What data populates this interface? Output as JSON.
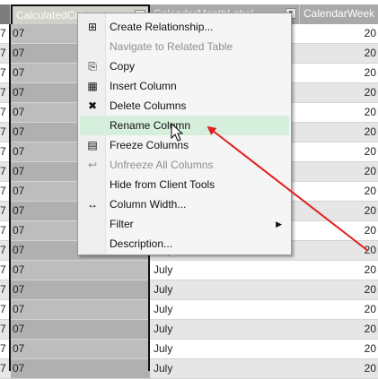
{
  "grid": {
    "columns": [
      "",
      "CalculatedColumn1",
      "CalendarMonthLabel",
      "CalendarWeek"
    ],
    "header_calc": "CalculatedCol",
    "header_month": "CalendarMonthLabel",
    "header_week": "CalendarWeek",
    "rows": [
      {
        "left": "7",
        "calc": "07",
        "month": "July",
        "week": "20"
      },
      {
        "left": "7",
        "calc": "07",
        "month": "July",
        "week": "20"
      },
      {
        "left": "7",
        "calc": "07",
        "month": "July",
        "week": "20"
      },
      {
        "left": "7",
        "calc": "07",
        "month": "July",
        "week": "20"
      },
      {
        "left": "7",
        "calc": "07",
        "month": "July",
        "week": "20"
      },
      {
        "left": "7",
        "calc": "07",
        "month": "July",
        "week": "20"
      },
      {
        "left": "7",
        "calc": "07",
        "month": "July",
        "week": "20"
      },
      {
        "left": "7",
        "calc": "07",
        "month": "July",
        "week": "20"
      },
      {
        "left": "7",
        "calc": "07",
        "month": "July",
        "week": "20"
      },
      {
        "left": "7",
        "calc": "07",
        "month": "July",
        "week": "20"
      },
      {
        "left": "7",
        "calc": "07",
        "month": "July",
        "week": "20"
      },
      {
        "left": "7",
        "calc": "07",
        "month": "July",
        "week": "20"
      },
      {
        "left": "7",
        "calc": "07",
        "month": "July",
        "week": "20"
      },
      {
        "left": "7",
        "calc": "07",
        "month": "July",
        "week": "20"
      },
      {
        "left": "7",
        "calc": "07",
        "month": "July",
        "week": "20"
      },
      {
        "left": "7",
        "calc": "07",
        "month": "July",
        "week": "20"
      },
      {
        "left": "7",
        "calc": "07",
        "month": "July",
        "week": "20"
      },
      {
        "left": "7",
        "calc": "07",
        "month": "July",
        "week": "20"
      }
    ]
  },
  "menu": {
    "items": [
      {
        "label": "Create Relationship...",
        "icon": "create-relationship-icon",
        "glyph": "⊞",
        "disabled": false
      },
      {
        "label": "Navigate to Related Table",
        "icon": "navigate-related-icon",
        "glyph": "",
        "disabled": true
      },
      {
        "label": "Copy",
        "icon": "copy-icon",
        "glyph": "⎘",
        "disabled": false
      },
      {
        "label": "Insert Column",
        "icon": "insert-column-icon",
        "glyph": "▦",
        "disabled": false
      },
      {
        "label": "Delete Columns",
        "icon": "delete-columns-icon",
        "glyph": "✖",
        "disabled": false
      },
      {
        "label": "Rename Column",
        "icon": "rename-column-icon",
        "glyph": "",
        "disabled": false,
        "hover": true
      },
      {
        "label": "Freeze Columns",
        "icon": "freeze-columns-icon",
        "glyph": "▤",
        "disabled": false
      },
      {
        "label": "Unfreeze All Columns",
        "icon": "unfreeze-columns-icon",
        "glyph": "↩",
        "disabled": true
      },
      {
        "label": "Hide from Client Tools",
        "icon": "hide-client-tools-icon",
        "glyph": "",
        "disabled": false
      },
      {
        "label": "Column Width...",
        "icon": "column-width-icon",
        "glyph": "↔",
        "disabled": false
      },
      {
        "label": "Filter",
        "icon": "filter-icon",
        "glyph": "",
        "disabled": false,
        "submenu": true
      },
      {
        "label": "Description...",
        "icon": "description-icon",
        "glyph": "",
        "disabled": false
      }
    ]
  },
  "colors": {
    "hover": "#d6efdd",
    "arrow": "#e02020"
  }
}
